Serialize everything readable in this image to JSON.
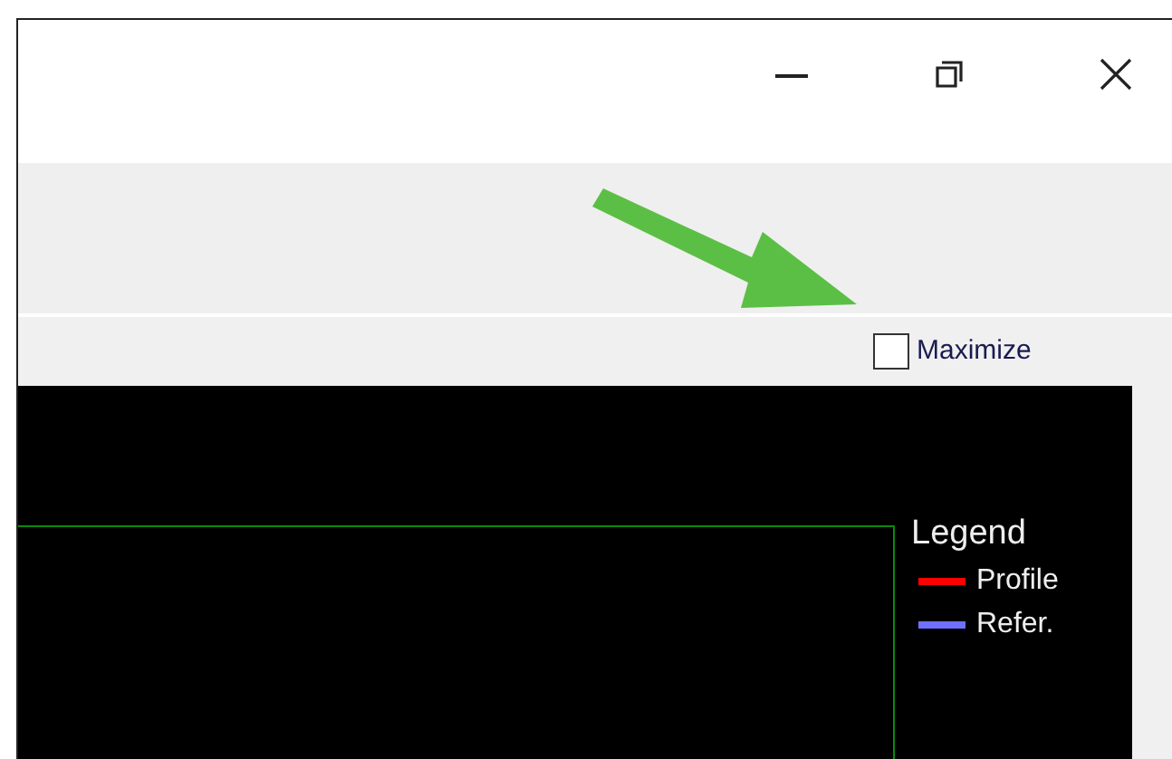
{
  "maximize": {
    "label": "Maximize",
    "checked": false
  },
  "legend": {
    "title": "Legend",
    "items": [
      {
        "label": "Profile",
        "color": "#ff0000"
      },
      {
        "label": "Refer.",
        "color": "#7070ff"
      }
    ]
  }
}
